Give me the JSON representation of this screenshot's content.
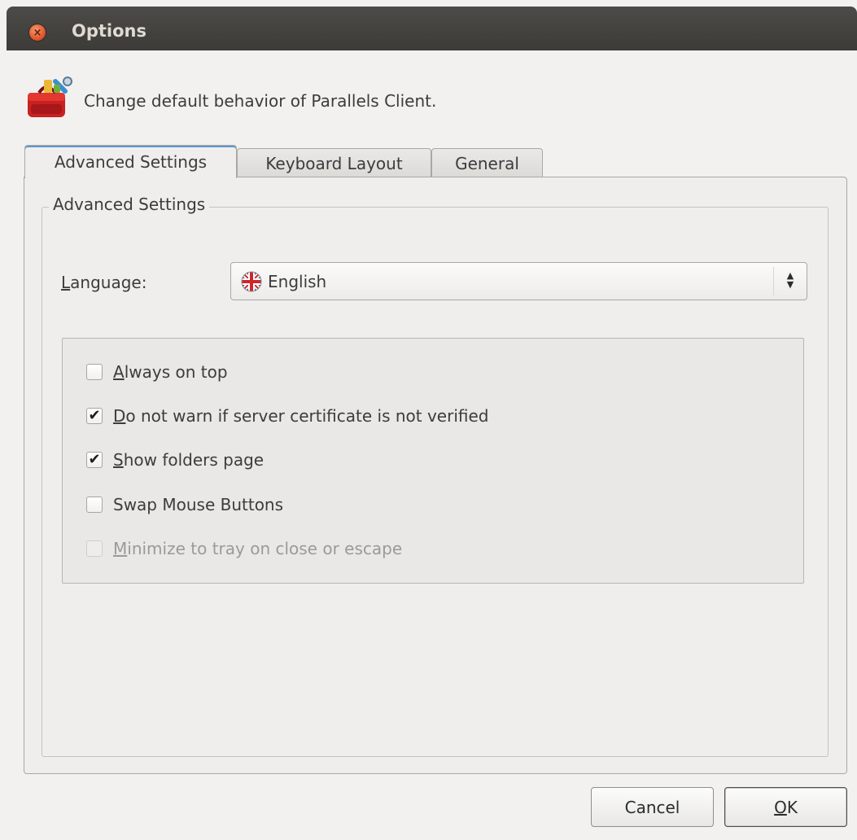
{
  "window": {
    "title": "Options",
    "close_glyph": "×"
  },
  "header": {
    "description": "Change default behavior of Parallels Client.",
    "icon": "toolbox-icon"
  },
  "tabs": [
    {
      "label": "Advanced Settings",
      "active": true
    },
    {
      "label": "Keyboard Layout",
      "active": false
    },
    {
      "label": "General",
      "active": false
    }
  ],
  "advanced": {
    "group_title": "Advanced Settings",
    "language_label": "Language:",
    "language_value": "English",
    "language_icon": "uk-flag-icon",
    "options": [
      {
        "label": "Always on top",
        "checked": false,
        "enabled": true
      },
      {
        "label": "Do not warn if server certificate is not verified",
        "checked": true,
        "enabled": true
      },
      {
        "label": "Show folders page",
        "checked": true,
        "enabled": true
      },
      {
        "label": "Swap Mouse Buttons",
        "checked": false,
        "enabled": true
      },
      {
        "label": "Minimize to tray on close or escape",
        "checked": false,
        "enabled": false
      }
    ]
  },
  "buttons": {
    "cancel": "Cancel",
    "ok": "OK"
  },
  "colors": {
    "titlebar": "#3c3b37",
    "close_button": "#e4572e",
    "window_bg": "#f2f1f0",
    "tab_accent": "#5e97d1"
  }
}
